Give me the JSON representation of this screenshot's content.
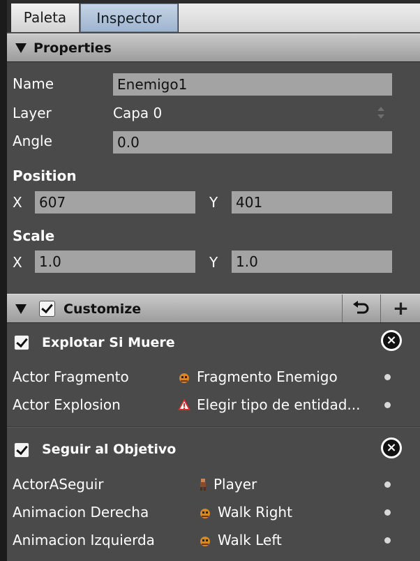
{
  "tabs": [
    {
      "label": "Paleta",
      "active": false
    },
    {
      "label": "Inspector",
      "active": true
    }
  ],
  "properties": {
    "title": "Properties",
    "name_label": "Name",
    "name_value": "Enemigo1",
    "layer_label": "Layer",
    "layer_value": "Capa 0",
    "angle_label": "Angle",
    "angle_value": "0.0",
    "position": {
      "title": "Position",
      "x_label": "X",
      "x_value": "607",
      "y_label": "Y",
      "y_value": "401"
    },
    "scale": {
      "title": "Scale",
      "x_label": "X",
      "x_value": "1.0",
      "y_label": "Y",
      "y_value": "1.0"
    }
  },
  "customize": {
    "title": "Customize",
    "checked": true,
    "revert_icon": "revert-icon",
    "add_icon": "+"
  },
  "behaviors": [
    {
      "title": "Explotar Si Muere",
      "checked": true,
      "close_icon": "×",
      "rows": [
        {
          "label": "Actor Fragmento",
          "value": "Fragmento Enemigo",
          "icon": "actor-sprite-icon"
        },
        {
          "label": "Actor Explosion",
          "value": "Elegir tipo de entidad...",
          "icon": "warning-icon"
        }
      ]
    },
    {
      "title": "Seguir al Objetivo",
      "checked": true,
      "close_icon": "×",
      "rows": [
        {
          "label": "ActorASeguir",
          "value": "Player",
          "icon": "player-sprite-icon"
        },
        {
          "label": "Animacion Derecha",
          "value": "Walk Right",
          "icon": "animation-icon"
        },
        {
          "label": "Animacion Izquierda",
          "value": "Walk Left",
          "icon": "animation-icon"
        }
      ]
    }
  ],
  "colors": {
    "panel_bg": "#4a4a4a",
    "field_bg": "#a3a3a3",
    "tab_active": "#aebfd6"
  }
}
